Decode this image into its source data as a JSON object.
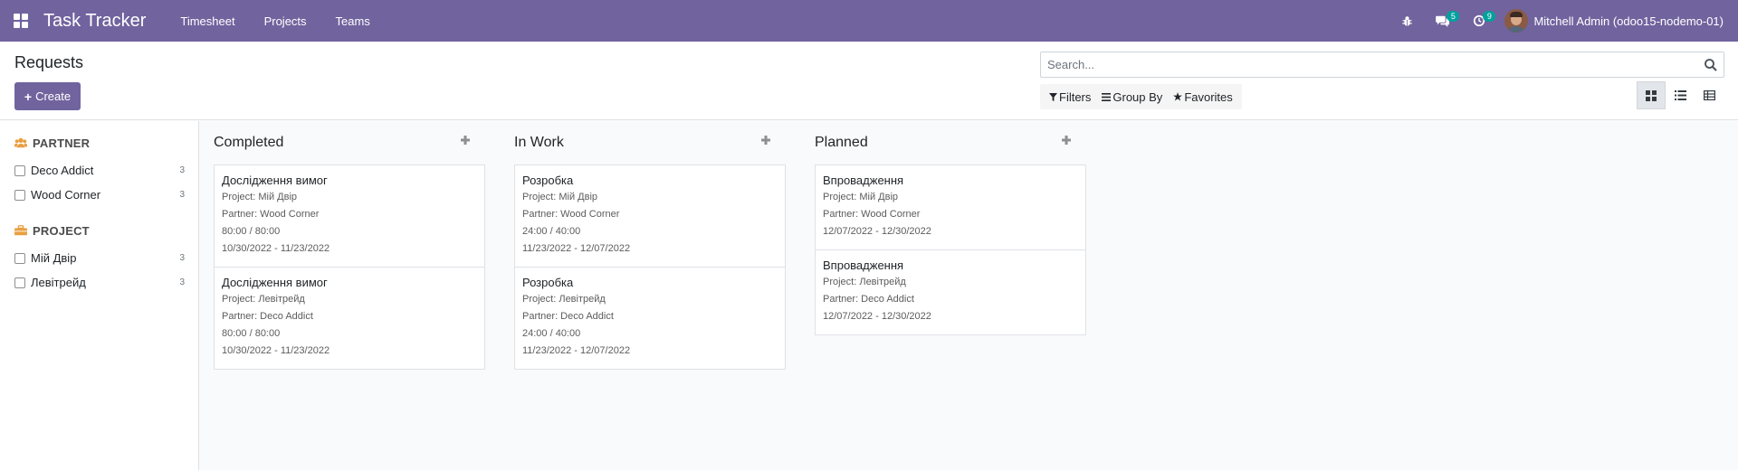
{
  "navbar": {
    "brand": "Task Tracker",
    "menu": [
      "Timesheet",
      "Projects",
      "Teams"
    ],
    "messages_count": "5",
    "activities_count": "9",
    "user": "Mitchell Admin (odoo15-nodemo-01)",
    "bg_color": "#71639e"
  },
  "control": {
    "title": "Requests",
    "create_label": "Create",
    "search_placeholder": "Search...",
    "filters_label": "Filters",
    "groupby_label": "Group By",
    "favorites_label": "Favorites",
    "views": [
      "kanban-view",
      "list-view",
      "grid-view"
    ],
    "active_view": "kanban-view"
  },
  "sidepanel": {
    "partner": {
      "heading": "PARTNER",
      "items": [
        {
          "label": "Deco Addict",
          "count": "3"
        },
        {
          "label": "Wood Corner",
          "count": "3"
        }
      ]
    },
    "project": {
      "heading": "PROJECT",
      "items": [
        {
          "label": "Мій Двір",
          "count": "3"
        },
        {
          "label": "Левітрейд",
          "count": "3"
        }
      ]
    }
  },
  "kanban": {
    "columns": [
      {
        "title": "Completed",
        "cards": [
          {
            "title": "Дослідження вимог",
            "project": "Project: Мій Двір",
            "partner": "Partner: Wood Corner",
            "hours": "80:00 / 80:00",
            "dates": "10/30/2022 - 11/23/2022"
          },
          {
            "title": "Дослідження вимог",
            "project": "Project: Левітрейд",
            "partner": "Partner: Deco Addict",
            "hours": "80:00 / 80:00",
            "dates": "10/30/2022 - 11/23/2022"
          }
        ]
      },
      {
        "title": "In Work",
        "cards": [
          {
            "title": "Розробка",
            "project": "Project: Мій Двір",
            "partner": "Partner: Wood Corner",
            "hours": "24:00 / 40:00",
            "dates": "11/23/2022 - 12/07/2022"
          },
          {
            "title": "Розробка",
            "project": "Project: Левітрейд",
            "partner": "Partner: Deco Addict",
            "hours": "24:00 / 40:00",
            "dates": "11/23/2022 - 12/07/2022"
          }
        ]
      },
      {
        "title": "Planned",
        "cards": [
          {
            "title": "Впровадження",
            "project": "Project: Мій Двір",
            "partner": "Partner: Wood Corner",
            "dates": "12/07/2022 - 12/30/2022"
          },
          {
            "title": "Впровадження",
            "project": "Project: Левітрейд",
            "partner": "Partner: Deco Addict",
            "dates": "12/07/2022 - 12/30/2022"
          }
        ]
      }
    ]
  }
}
